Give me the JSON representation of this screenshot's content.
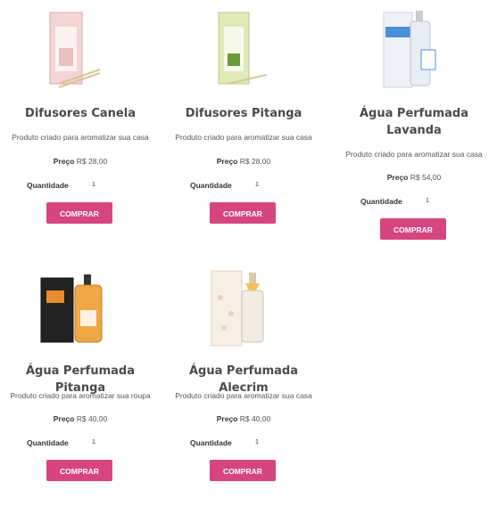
{
  "products": [
    {
      "title": "Difusores Canela",
      "desc": "Produto criado para aromatizar sua casa",
      "price_label": "Preço",
      "price": "R$ 28,00",
      "qty_label": "Quantidade",
      "qty": "1",
      "button": "COMPRAR"
    },
    {
      "title": "Difusores Pitanga",
      "desc": "Produto criado para aromatizar sua casa",
      "price_label": "Preço",
      "price": "R$ 28,00",
      "qty_label": "Quantidade",
      "qty": "1",
      "button": "COMPRAR"
    },
    {
      "title": "Água Perfumada Lavanda",
      "desc": "Produto criado para aromatizar sua casa",
      "price_label": "Preço",
      "price": "R$ 54,00",
      "qty_label": "Quantidade",
      "qty": "1",
      "button": "COMPRAR"
    },
    {
      "title": "Água Perfumada Pitanga",
      "desc": "Produto criado para aromatizar sua roupa",
      "price_label": "Preço",
      "price": "R$ 40,00",
      "qty_label": "Quantidade",
      "qty": "1",
      "button": "COMPRAR"
    },
    {
      "title": "Água Perfumada Alecrim",
      "desc": "Produto criado para aromatizar sua casa",
      "price_label": "Preço",
      "price": "R$ 40,00",
      "qty_label": "Quantidade",
      "qty": "1",
      "button": "COMPRAR"
    }
  ]
}
